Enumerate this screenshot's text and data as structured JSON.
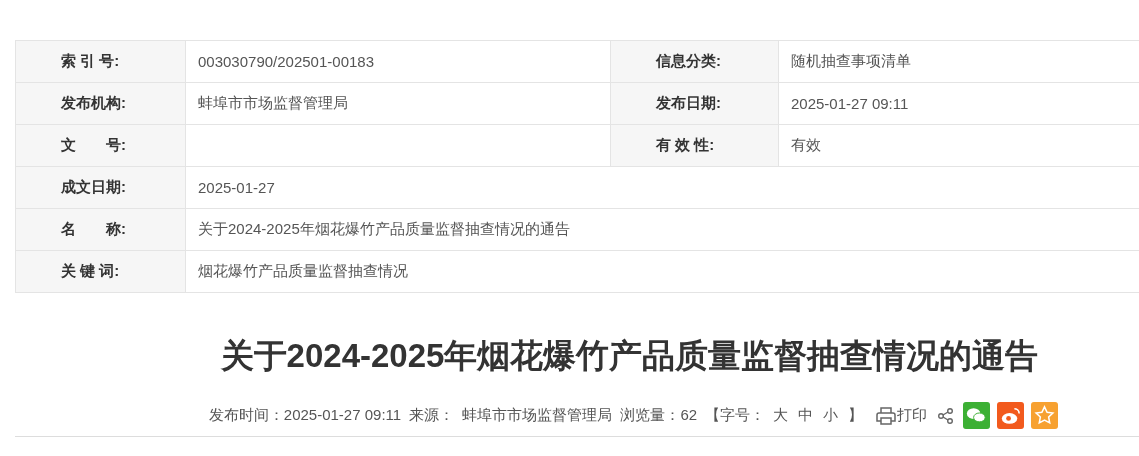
{
  "info_table": {
    "rows": [
      {
        "cells": [
          {
            "label": "索 引 号:",
            "value": "003030790/202501-00183"
          },
          {
            "label": "信息分类:",
            "value": "随机抽查事项清单"
          }
        ]
      },
      {
        "cells": [
          {
            "label": "发布机构:",
            "value": "蚌埠市市场监督管理局"
          },
          {
            "label": "发布日期:",
            "value": "2025-01-27 09:11"
          }
        ]
      },
      {
        "cells": [
          {
            "label": "文　　号:"
          },
          {
            "label": "有 效 性:",
            "value": "有效"
          }
        ]
      },
      {
        "cells": [
          {
            "label": "成文日期:",
            "value": "2025-01-27"
          }
        ]
      },
      {
        "cells": [
          {
            "label": "名　　称:",
            "value": "关于2024-2025年烟花爆竹产品质量监督抽查情况的通告"
          }
        ]
      },
      {
        "cells": [
          {
            "label": "关 键 词:",
            "value": "烟花爆竹产品质量监督抽查情况"
          }
        ]
      }
    ]
  },
  "article": {
    "title": "关于2024-2025年烟花爆竹产品质量监督抽查情况的通告",
    "meta": [
      "发布时间：2025-01-27 09:11",
      "来源：  蚌埠市市场监督管理局",
      "浏览量：62"
    ],
    "font_size": {
      "open": "【字号：",
      "sizes": [
        "大",
        "中",
        "小"
      ],
      "close": "】"
    },
    "print": "打印"
  }
}
